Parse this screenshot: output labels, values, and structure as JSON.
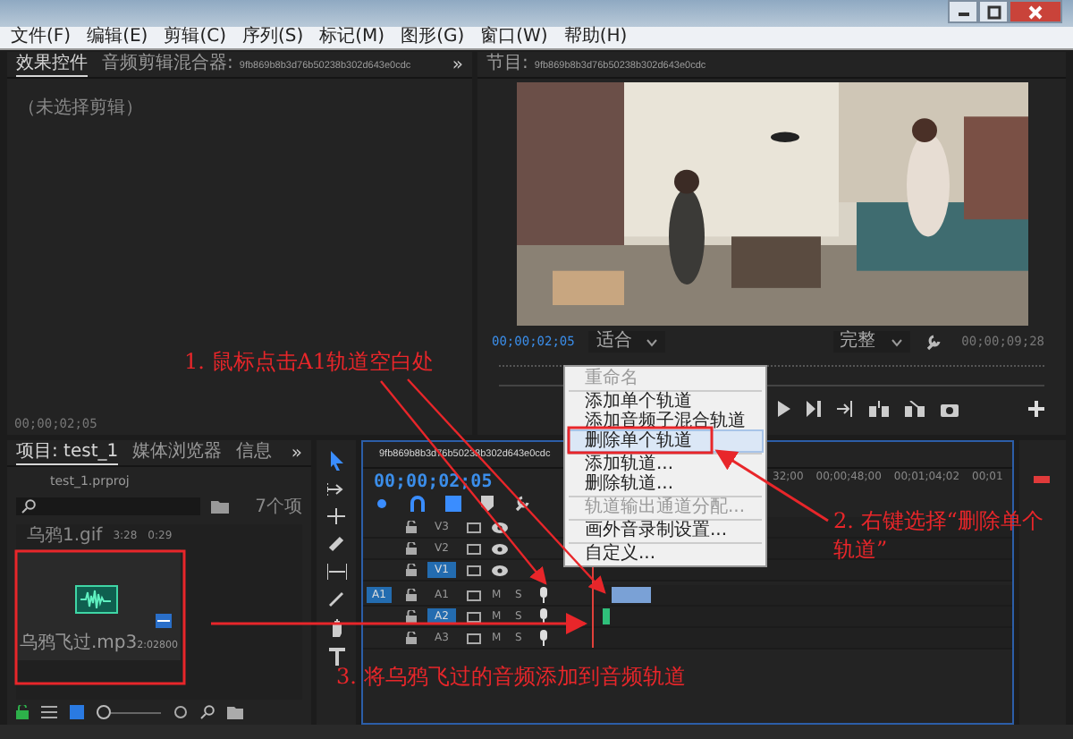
{
  "menu": [
    "文件(F)",
    "编辑(E)",
    "剪辑(C)",
    "序列(S)",
    "标记(M)",
    "图形(G)",
    "窗口(W)",
    "帮助(H)"
  ],
  "effects_panel": {
    "tabs": [
      {
        "label": "效果控件",
        "selected": true
      },
      {
        "label": "音频剪辑混合器: 9fb869b8b3d76b50238b302d643e0cdc",
        "selected": false
      }
    ],
    "overflow": "»",
    "empty_text": "（未选择剪辑）",
    "timecode": "00;00;02;05"
  },
  "program_monitor": {
    "title": "节目: 9fb869b8b3d76b50238b302d643e0cdc",
    "timecode": "00;00;02;05",
    "zoom": "适合",
    "quality": "完整",
    "duration": "00;00;09;28"
  },
  "project_panel": {
    "tabs": [
      {
        "label": "项目: test_1",
        "selected": true
      },
      {
        "label": "媒体浏览器",
        "selected": false
      },
      {
        "label": "信息",
        "selected": false
      }
    ],
    "overflow": "»",
    "project_file": "test_1.prproj",
    "item_count": "7个项",
    "list_row": [
      "乌鸦1.gif",
      "3:28",
      "0:29"
    ],
    "clip": {
      "name": "乌鸦飞过.mp3",
      "duration": "2:02800"
    },
    "thumbnail_size": {
      "level": 0
    }
  },
  "timeline": {
    "title": "9fb869b8b3d76b50238b302d643e0cdc",
    "timecode": "00;00;02;05",
    "ruler": [
      "32;00",
      "00;00;48;00",
      "00;01;04;02",
      "00;01"
    ],
    "tracks": [
      {
        "kind": "video",
        "label": "V3",
        "selected": false
      },
      {
        "kind": "video",
        "label": "V2",
        "selected": false
      },
      {
        "kind": "video",
        "label": "V1",
        "selected": true
      },
      {
        "kind": "audio",
        "label": "A1",
        "selected": false,
        "target": "A1",
        "buttons": [
          "M",
          "S"
        ]
      },
      {
        "kind": "audio",
        "label": "A2",
        "selected": true,
        "buttons": [
          "M",
          "S"
        ]
      },
      {
        "kind": "audio",
        "label": "A3",
        "selected": false,
        "buttons": [
          "M",
          "S"
        ]
      }
    ]
  },
  "context_menu": [
    {
      "label": "重命名",
      "disabled": true,
      "selected": false,
      "separator_before": false
    },
    {
      "label": "添加单个轨道",
      "disabled": false,
      "selected": false,
      "separator_before": true
    },
    {
      "label": "添加音频子混合轨道",
      "disabled": false,
      "selected": false,
      "separator_before": false
    },
    {
      "label": "删除单个轨道",
      "disabled": false,
      "selected": true,
      "separator_before": false
    },
    {
      "label": "添加轨道...",
      "disabled": false,
      "selected": false,
      "separator_before": true
    },
    {
      "label": "删除轨道...",
      "disabled": false,
      "selected": false,
      "separator_before": false
    },
    {
      "label": "轨道输出通道分配...",
      "disabled": true,
      "selected": false,
      "separator_before": true
    },
    {
      "label": "画外音录制设置...",
      "disabled": false,
      "selected": false,
      "separator_before": true
    },
    {
      "label": "自定义...",
      "disabled": false,
      "selected": false,
      "separator_before": true
    }
  ],
  "annotations": [
    {
      "text": "1. 鼠标点击A1轨道空白处"
    },
    {
      "text": "2. 右键选择“删除单个轨道”"
    },
    {
      "text": "3. 将乌鸦飞过的音频添加到音频轨道"
    }
  ]
}
